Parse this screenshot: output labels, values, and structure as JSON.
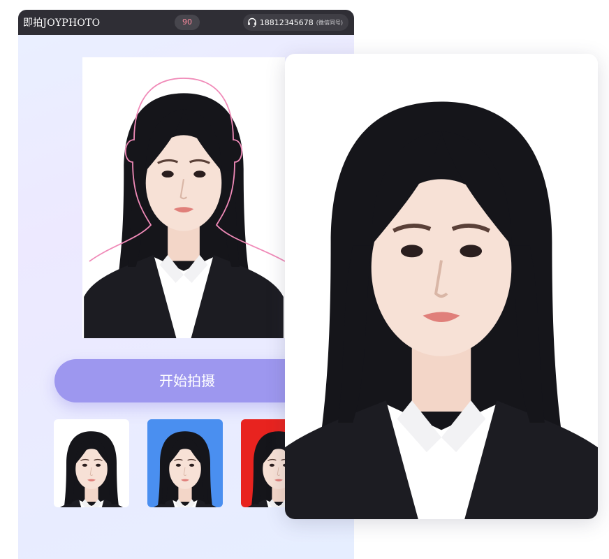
{
  "app": {
    "brand": "即拍JOYPHOTO",
    "countdown": "90",
    "hotline_number": "18812345678",
    "hotline_note": "(微信同号)"
  },
  "main": {
    "start_button_label": "开始拍摄"
  },
  "thumbnails": [
    {
      "background": "#ffffff"
    },
    {
      "background": "#4a8ff0"
    },
    {
      "background": "#e8231f"
    }
  ],
  "colors": {
    "topbar": "#2f2e35",
    "accent_button": "#9d97ef",
    "countdown_text": "#ff8ca0",
    "guide_outline": "#f08ab8"
  },
  "icons": [
    "headset-icon"
  ]
}
